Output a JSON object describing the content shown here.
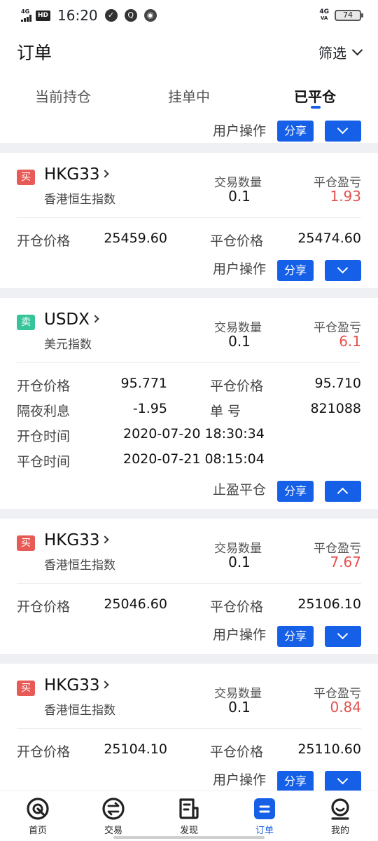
{
  "status_bar": {
    "network_left": "4G",
    "hd": "HD",
    "time": "16:20",
    "network_right_top": "4G",
    "network_right_bottom": "VA",
    "battery": "74"
  },
  "header": {
    "title": "订单",
    "filter_label": "筛选"
  },
  "tabs": [
    {
      "label": "当前持仓",
      "active": false
    },
    {
      "label": "挂单中",
      "active": false
    },
    {
      "label": "已平仓",
      "active": true
    }
  ],
  "partial_top": {
    "action_label": "用户操作",
    "share_label": "分享"
  },
  "orders": [
    {
      "side": "买",
      "side_color": "#e85a55",
      "symbol": "HKG33",
      "name": "香港恒生指数",
      "qty_label": "交易数量",
      "qty": "0.1",
      "pnl_label": "平仓盈亏",
      "pnl": "1.93",
      "open_price_label": "开仓价格",
      "open_price": "25459.60",
      "close_price_label": "平仓价格",
      "close_price": "25474.60",
      "action_label": "用户操作",
      "share_label": "分享",
      "expanded": false
    },
    {
      "side": "卖",
      "side_color": "#36c49a",
      "symbol": "USDX",
      "name": "美元指数",
      "qty_label": "交易数量",
      "qty": "0.1",
      "pnl_label": "平仓盈亏",
      "pnl": "6.1",
      "open_price_label": "开仓价格",
      "open_price": "95.771",
      "close_price_label": "平仓价格",
      "close_price": "95.710",
      "swap_label": "隔夜利息",
      "swap": "-1.95",
      "order_no_label": "单 号",
      "order_no": "821088",
      "open_time_label": "开仓时间",
      "open_time": "2020-07-20 18:30:34",
      "close_time_label": "平仓时间",
      "close_time": "2020-07-21 08:15:04",
      "action_label": "止盈平仓",
      "share_label": "分享",
      "expanded": true
    },
    {
      "side": "买",
      "side_color": "#e85a55",
      "symbol": "HKG33",
      "name": "香港恒生指数",
      "qty_label": "交易数量",
      "qty": "0.1",
      "pnl_label": "平仓盈亏",
      "pnl": "7.67",
      "open_price_label": "开仓价格",
      "open_price": "25046.60",
      "close_price_label": "平仓价格",
      "close_price": "25106.10",
      "action_label": "用户操作",
      "share_label": "分享",
      "expanded": false
    },
    {
      "side": "买",
      "side_color": "#e85a55",
      "symbol": "HKG33",
      "name": "香港恒生指数",
      "qty_label": "交易数量",
      "qty": "0.1",
      "pnl_label": "平仓盈亏",
      "pnl": "0.84",
      "open_price_label": "开仓价格",
      "open_price": "25104.10",
      "close_price_label": "平仓价格",
      "close_price": "25110.60",
      "action_label": "用户操作",
      "share_label": "分享",
      "expanded": false
    }
  ],
  "bottom_nav": [
    {
      "label": "首页",
      "icon": "home-icon",
      "active": false
    },
    {
      "label": "交易",
      "icon": "exchange-icon",
      "active": false
    },
    {
      "label": "发现",
      "icon": "discover-icon",
      "active": false
    },
    {
      "label": "订单",
      "icon": "orders-icon",
      "active": true
    },
    {
      "label": "我的",
      "icon": "profile-icon",
      "active": false
    }
  ],
  "colors": {
    "accent": "#1660e8",
    "loss_profit": "#e5514d",
    "buy": "#e85a55",
    "sell": "#36c49a"
  }
}
